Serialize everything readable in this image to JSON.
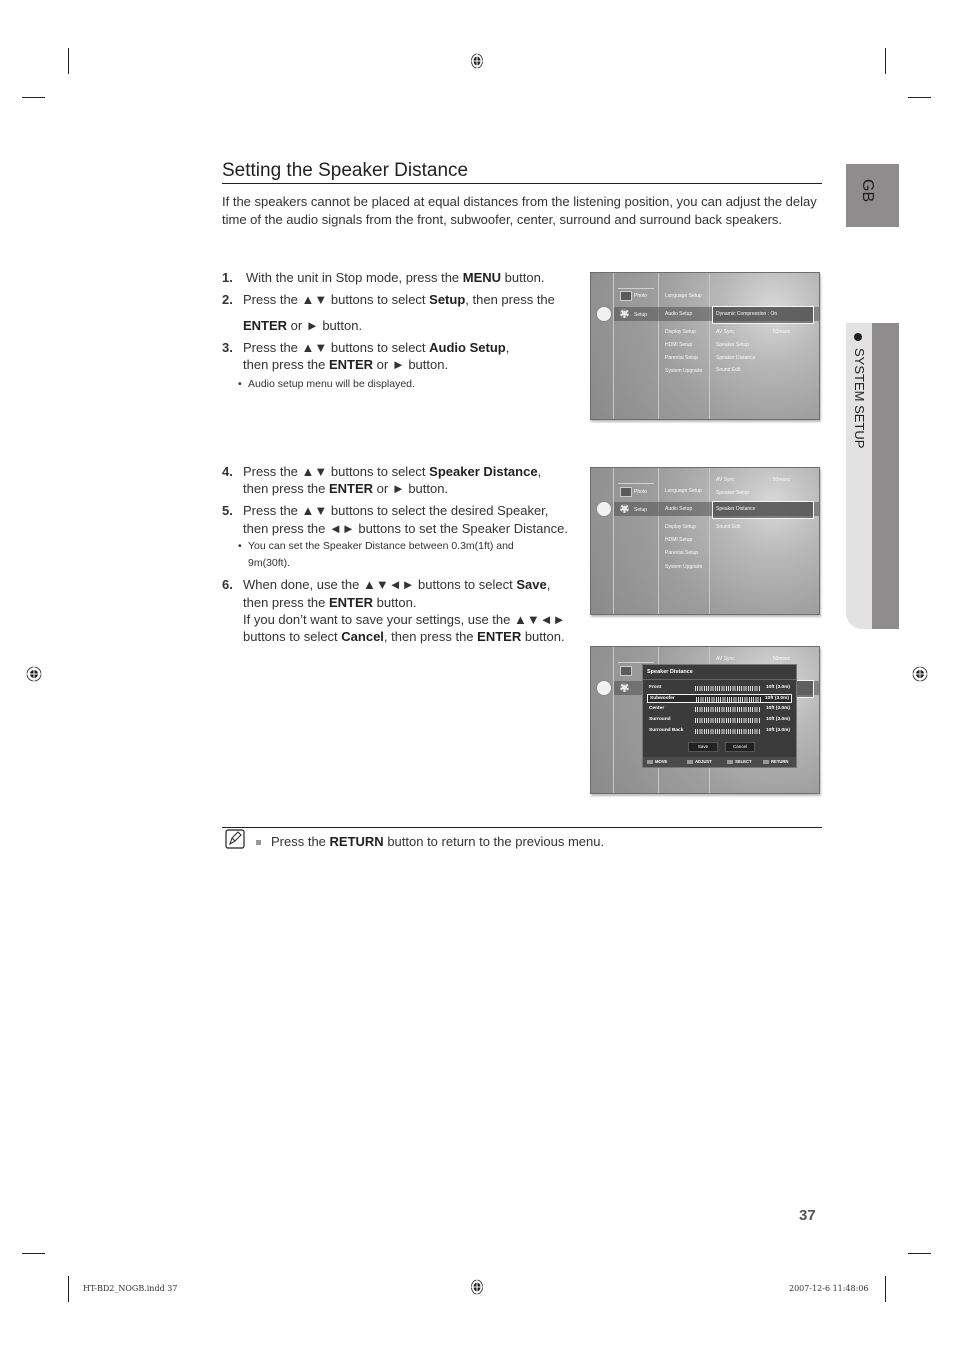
{
  "page": {
    "title": "Setting the Speaker Distance",
    "intro": "If the speakers cannot be placed at equal distances from the listening position, you can adjust the delay time of the audio signals from the front, subwoofer, center, surround and surround back speakers.",
    "page_number": "37",
    "language_tab": "GB",
    "section_tab": "SYSTEM SETUP"
  },
  "steps": [
    {
      "num": "1.",
      "parts": [
        {
          "t": "With the unit in Stop mode, press the "
        },
        {
          "t": "MENU",
          "b": true
        },
        {
          "t": " button."
        }
      ]
    },
    {
      "num": "2.",
      "parts": [
        {
          "t": "Press the ▲▼ buttons to select "
        },
        {
          "t": "Setup",
          "b": true
        },
        {
          "t": ", then press the"
        }
      ],
      "cont": [
        {
          "t": "ENTER",
          "b": true
        },
        {
          "t": " or ► button."
        }
      ]
    },
    {
      "num": "3.",
      "parts": [
        {
          "t": "Press the ▲▼ buttons to select "
        },
        {
          "t": "Audio Setup",
          "b": true
        },
        {
          "t": ","
        }
      ],
      "line2": [
        {
          "t": "then press the "
        },
        {
          "t": "ENTER",
          "b": true
        },
        {
          "t": " or ► button."
        }
      ],
      "bullet": "Audio setup menu will be displayed."
    },
    {
      "num": "4.",
      "parts": [
        {
          "t": "Press the ▲▼ buttons to select "
        },
        {
          "t": "Speaker Distance",
          "b": true
        },
        {
          "t": ","
        }
      ],
      "line2": [
        {
          "t": "then press the "
        },
        {
          "t": "ENTER",
          "b": true
        },
        {
          "t": " or ► button."
        }
      ]
    },
    {
      "num": "5.",
      "parts": [
        {
          "t": "Press the ▲▼ buttons to select the desired Speaker,"
        }
      ],
      "line2": [
        {
          "t": "then press the ◄► buttons to set the Speaker Distance."
        }
      ],
      "bullet": "You can set the Speaker Distance between 0.3m(1ft) and 9m(30ft)."
    },
    {
      "num": "6.",
      "parts": [
        {
          "t": "When done, use the ▲▼◄► buttons to select "
        },
        {
          "t": "Save",
          "b": true
        },
        {
          "t": ","
        }
      ],
      "line2": [
        {
          "t": "then press the "
        },
        {
          "t": "ENTER",
          "b": true
        },
        {
          "t": " button."
        }
      ],
      "line3": [
        {
          "t": "If you don’t want to save your settings, use the ▲▼◄►"
        }
      ],
      "line4": [
        {
          "t": "buttons to select "
        },
        {
          "t": "Cancel",
          "b": true
        },
        {
          "t": ", then press the "
        },
        {
          "t": "ENTER",
          "b": true
        },
        {
          "t": " button."
        }
      ]
    }
  ],
  "screens": {
    "left_menu": [
      "Photo",
      "Setup"
    ],
    "setup_menu": [
      "Language Setup",
      "Audio Setup",
      "Display Setup",
      "HDMI Setup",
      "Parental Setup",
      "System Upgrade"
    ],
    "audio_menu": {
      "dynamic_compression": "Dynamic Compression :  On",
      "av_sync_label": "AV Sync",
      "av_sync_value": ":  50msec",
      "speaker_setup": "Speaker Setup",
      "speaker_distance": "Speaker Distance",
      "sound_edit": "Sound Edit"
    },
    "dialog": {
      "title": "Speaker Distance",
      "rows": [
        {
          "label": "Front",
          "value": "10ft (3.0m)",
          "level": 0.33
        },
        {
          "label": "Subwoofer",
          "value": "10ft (3.0m)",
          "level": 0.33
        },
        {
          "label": "Center",
          "value": "10ft (3.0m)",
          "level": 0.33
        },
        {
          "label": "Surround",
          "value": "10ft (3.0m)",
          "level": 0.33
        },
        {
          "label": "Surround Back",
          "value": "10ft (3.0m)",
          "level": 0.33
        }
      ],
      "save": "Save",
      "cancel": "Cancel",
      "footer": [
        "MOVE",
        "ADJUST",
        "SELECT",
        "RETURN"
      ]
    }
  },
  "note": {
    "pre": "Press the ",
    "bold": "RETURN",
    "post": " button to return to the previous menu."
  },
  "slug": {
    "file": "HT-BD2_NOGB.indd   37",
    "datetime": "2007-12-6   11:48:06"
  }
}
